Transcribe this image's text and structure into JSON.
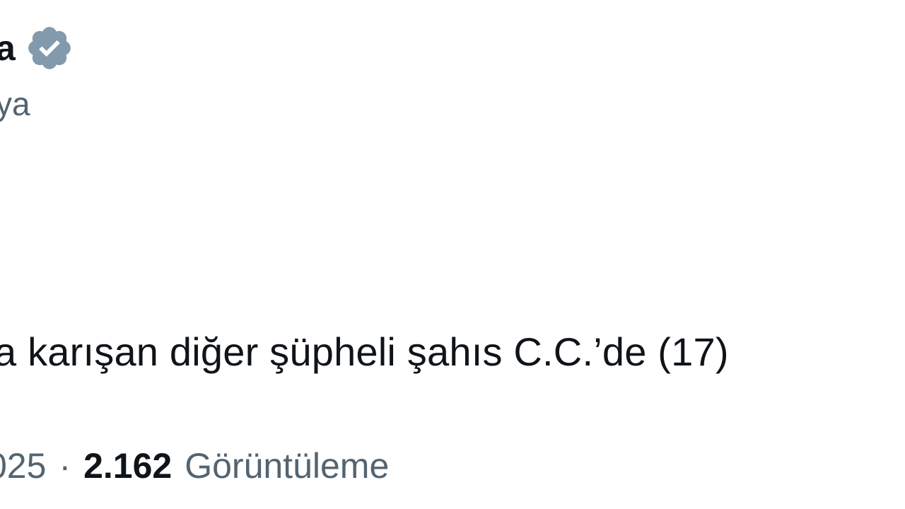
{
  "tweet": {
    "display_name": "a",
    "handle": "ya",
    "text": "a karışan diğer şüpheli şahıs C.C.’de  (17)",
    "date": "025",
    "separator": "·",
    "view_count": "2.162",
    "view_label": "Görüntüleme"
  },
  "icons": {
    "verified": "verified-badge-icon"
  },
  "colors": {
    "text_primary": "#0f1419",
    "text_secondary": "#536471",
    "verified_badge": "#829aab",
    "background": "#ffffff"
  }
}
